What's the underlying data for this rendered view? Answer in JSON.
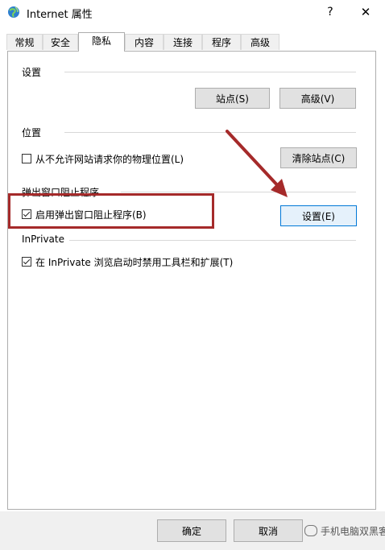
{
  "window": {
    "title": "Internet 属性",
    "help_glyph": "?",
    "close_glyph": "✕"
  },
  "tabs": [
    {
      "label": "常规"
    },
    {
      "label": "安全"
    },
    {
      "label": "隐私",
      "active": true
    },
    {
      "label": "内容"
    },
    {
      "label": "连接"
    },
    {
      "label": "程序"
    },
    {
      "label": "高级"
    }
  ],
  "settings_group": {
    "label": "设置",
    "sites_button": "站点(S)",
    "advanced_button": "高级(V)"
  },
  "location_group": {
    "label": "位置",
    "checkbox_label": "从不允许网站请求你的物理位置(L)",
    "checkbox_checked": false,
    "clear_button": "清除站点(C)"
  },
  "popup_group": {
    "label": "弹出窗口阻止程序",
    "checkbox_label": "启用弹出窗口阻止程序(B)",
    "checkbox_checked": true,
    "settings_button": "设置(E)"
  },
  "inprivate_group": {
    "label": "InPrivate",
    "checkbox_label": "在 InPrivate 浏览启动时禁用工具栏和扩展(T)",
    "checkbox_checked": true
  },
  "footer": {
    "ok_button": "确定",
    "cancel_button": "取消",
    "watermark": "手机电脑双黑客"
  },
  "colors": {
    "annotation_red": "#a52a2a",
    "focus_blue": "#0078d7"
  }
}
